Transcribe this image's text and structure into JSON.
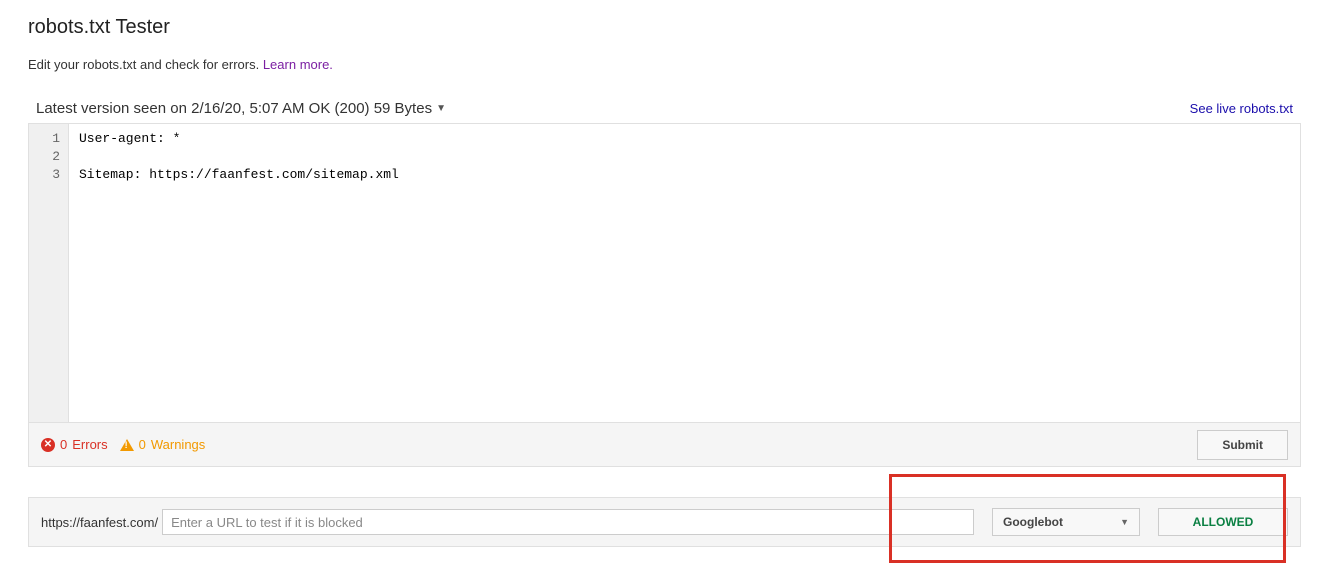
{
  "header": {
    "title": "robots.txt Tester",
    "intro": "Edit your robots.txt and check for errors. ",
    "learn_more": "Learn more."
  },
  "version_bar": {
    "label": "Latest version seen on 2/16/20, 5:07 AM OK (200) 59 Bytes",
    "see_live": "See live robots.txt"
  },
  "editor": {
    "lines": [
      "User-agent: *",
      "",
      "Sitemap: https://faanfest.com/sitemap.xml"
    ]
  },
  "status": {
    "errors_count": "0",
    "errors_label": "Errors",
    "warnings_count": "0",
    "warnings_label": "Warnings",
    "submit_label": "Submit"
  },
  "tester": {
    "url_prefix": "https://faanfest.com/",
    "url_placeholder": "Enter a URL to test if it is blocked",
    "url_value": "",
    "bot_selected": "Googlebot",
    "result": "ALLOWED"
  }
}
